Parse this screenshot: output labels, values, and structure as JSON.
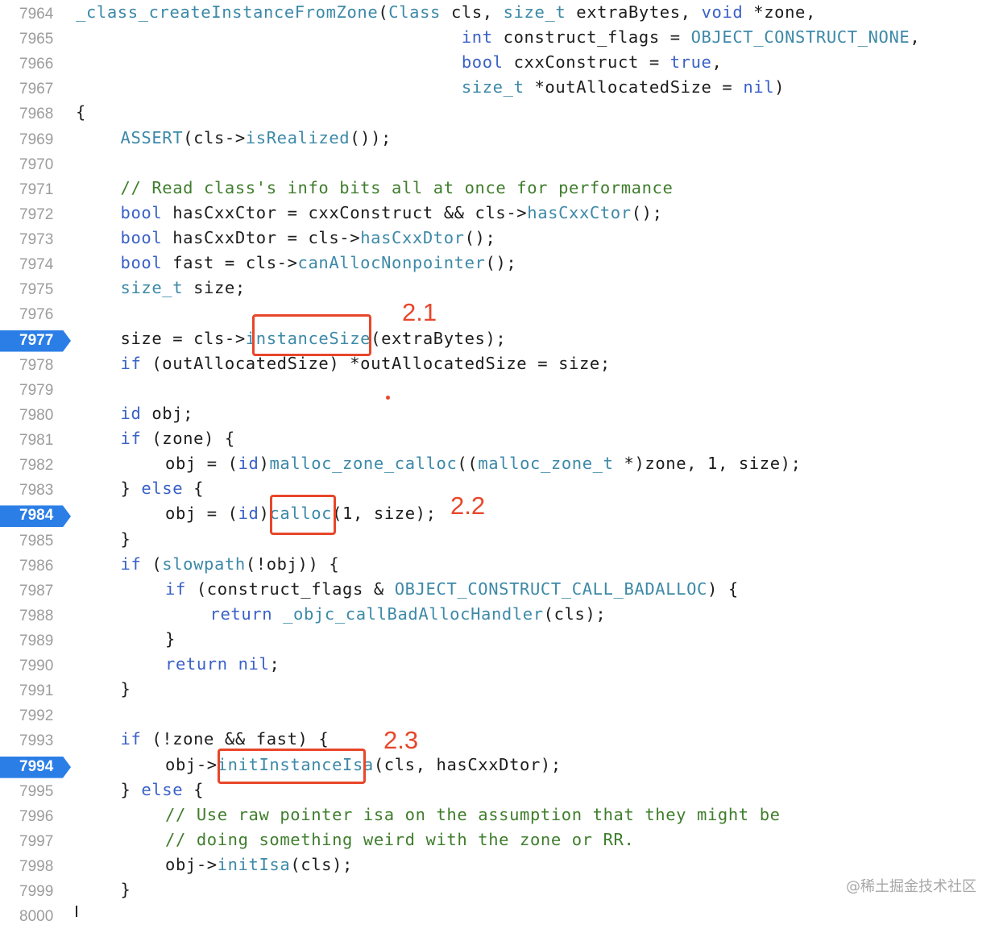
{
  "lines": [
    {
      "num": "7964",
      "indent": 0,
      "tokens": [
        {
          "t": "_class_createInstanceFromZone",
          "c": "fn"
        },
        {
          "t": "(",
          "c": "pl"
        },
        {
          "t": "Class",
          "c": "fn"
        },
        {
          "t": " cls, ",
          "c": "pl"
        },
        {
          "t": "size_t",
          "c": "fn"
        },
        {
          "t": " extraBytes, ",
          "c": "pl"
        },
        {
          "t": "void",
          "c": "kw"
        },
        {
          "t": " *zone,",
          "c": "pl"
        }
      ]
    },
    {
      "num": "7965",
      "indent": 0,
      "tokens": [
        {
          "t": "                                     ",
          "c": "pl"
        },
        {
          "t": "int",
          "c": "kw"
        },
        {
          "t": " construct_flags = ",
          "c": "pl"
        },
        {
          "t": "OBJECT_CONSTRUCT_NONE",
          "c": "mac"
        },
        {
          "t": ",",
          "c": "pl"
        }
      ]
    },
    {
      "num": "7966",
      "indent": 0,
      "tokens": [
        {
          "t": "                                     ",
          "c": "pl"
        },
        {
          "t": "bool",
          "c": "kw"
        },
        {
          "t": " cxxConstruct = ",
          "c": "pl"
        },
        {
          "t": "true",
          "c": "kw"
        },
        {
          "t": ",",
          "c": "pl"
        }
      ]
    },
    {
      "num": "7967",
      "indent": 0,
      "tokens": [
        {
          "t": "                                     ",
          "c": "pl"
        },
        {
          "t": "size_t",
          "c": "fn"
        },
        {
          "t": " *outAllocatedSize = ",
          "c": "pl"
        },
        {
          "t": "nil",
          "c": "kw"
        },
        {
          "t": ")",
          "c": "pl"
        }
      ]
    },
    {
      "num": "7968",
      "indent": 0,
      "tokens": [
        {
          "t": "{",
          "c": "pl"
        }
      ]
    },
    {
      "num": "7969",
      "indent": 1,
      "tokens": [
        {
          "t": "ASSERT",
          "c": "mac"
        },
        {
          "t": "(cls->",
          "c": "pl"
        },
        {
          "t": "isRealized",
          "c": "fn"
        },
        {
          "t": "());",
          "c": "pl"
        }
      ]
    },
    {
      "num": "7970",
      "indent": 0,
      "tokens": []
    },
    {
      "num": "7971",
      "indent": 1,
      "tokens": [
        {
          "t": "// Read class's info bits all at once for performance",
          "c": "cm"
        }
      ]
    },
    {
      "num": "7972",
      "indent": 1,
      "tokens": [
        {
          "t": "bool",
          "c": "kw"
        },
        {
          "t": " hasCxxCtor = cxxConstruct && cls->",
          "c": "pl"
        },
        {
          "t": "hasCxxCtor",
          "c": "fn"
        },
        {
          "t": "();",
          "c": "pl"
        }
      ]
    },
    {
      "num": "7973",
      "indent": 1,
      "tokens": [
        {
          "t": "bool",
          "c": "kw"
        },
        {
          "t": " hasCxxDtor = cls->",
          "c": "pl"
        },
        {
          "t": "hasCxxDtor",
          "c": "fn"
        },
        {
          "t": "();",
          "c": "pl"
        }
      ]
    },
    {
      "num": "7974",
      "indent": 1,
      "tokens": [
        {
          "t": "bool",
          "c": "kw"
        },
        {
          "t": " fast = cls->",
          "c": "pl"
        },
        {
          "t": "canAllocNonpointer",
          "c": "fn"
        },
        {
          "t": "();",
          "c": "pl"
        }
      ]
    },
    {
      "num": "7975",
      "indent": 1,
      "tokens": [
        {
          "t": "size_t",
          "c": "fn"
        },
        {
          "t": " size;",
          "c": "pl"
        }
      ]
    },
    {
      "num": "7976",
      "indent": 0,
      "tokens": []
    },
    {
      "num": "7977",
      "indent": 1,
      "bp": true,
      "tokens": [
        {
          "t": "size = cls->",
          "c": "pl"
        },
        {
          "t": "instanceSize",
          "c": "fn"
        },
        {
          "t": "(extraBytes);",
          "c": "pl"
        }
      ]
    },
    {
      "num": "7978",
      "indent": 1,
      "tokens": [
        {
          "t": "if",
          "c": "kw"
        },
        {
          "t": " (outAllocatedSize) *outAllocatedSize = size;",
          "c": "pl"
        }
      ]
    },
    {
      "num": "7979",
      "indent": 0,
      "tokens": []
    },
    {
      "num": "7980",
      "indent": 1,
      "tokens": [
        {
          "t": "id",
          "c": "kw"
        },
        {
          "t": " obj;",
          "c": "pl"
        }
      ]
    },
    {
      "num": "7981",
      "indent": 1,
      "tokens": [
        {
          "t": "if",
          "c": "kw"
        },
        {
          "t": " (zone) {",
          "c": "pl"
        }
      ]
    },
    {
      "num": "7982",
      "indent": 2,
      "tokens": [
        {
          "t": "obj = (",
          "c": "pl"
        },
        {
          "t": "id",
          "c": "kw"
        },
        {
          "t": ")",
          "c": "pl"
        },
        {
          "t": "malloc_zone_calloc",
          "c": "fn"
        },
        {
          "t": "((",
          "c": "pl"
        },
        {
          "t": "malloc_zone_t",
          "c": "fn"
        },
        {
          "t": " *)zone, 1, size);",
          "c": "pl"
        }
      ]
    },
    {
      "num": "7983",
      "indent": 1,
      "tokens": [
        {
          "t": "} ",
          "c": "pl"
        },
        {
          "t": "else",
          "c": "kw"
        },
        {
          "t": " {",
          "c": "pl"
        }
      ]
    },
    {
      "num": "7984",
      "indent": 2,
      "bp": true,
      "tokens": [
        {
          "t": "obj = (",
          "c": "pl"
        },
        {
          "t": "id",
          "c": "kw"
        },
        {
          "t": ")",
          "c": "pl"
        },
        {
          "t": "calloc",
          "c": "fn"
        },
        {
          "t": "(1, size);",
          "c": "pl"
        }
      ]
    },
    {
      "num": "7985",
      "indent": 1,
      "tokens": [
        {
          "t": "}",
          "c": "pl"
        }
      ]
    },
    {
      "num": "7986",
      "indent": 1,
      "tokens": [
        {
          "t": "if",
          "c": "kw"
        },
        {
          "t": " (",
          "c": "pl"
        },
        {
          "t": "slowpath",
          "c": "fn"
        },
        {
          "t": "(!obj)) {",
          "c": "pl"
        }
      ]
    },
    {
      "num": "7987",
      "indent": 2,
      "tokens": [
        {
          "t": "if",
          "c": "kw"
        },
        {
          "t": " (construct_flags & ",
          "c": "pl"
        },
        {
          "t": "OBJECT_CONSTRUCT_CALL_BADALLOC",
          "c": "mac"
        },
        {
          "t": ") {",
          "c": "pl"
        }
      ]
    },
    {
      "num": "7988",
      "indent": 3,
      "tokens": [
        {
          "t": "return",
          "c": "kw"
        },
        {
          "t": " ",
          "c": "pl"
        },
        {
          "t": "_objc_callBadAllocHandler",
          "c": "fn"
        },
        {
          "t": "(cls);",
          "c": "pl"
        }
      ]
    },
    {
      "num": "7989",
      "indent": 2,
      "tokens": [
        {
          "t": "}",
          "c": "pl"
        }
      ]
    },
    {
      "num": "7990",
      "indent": 2,
      "tokens": [
        {
          "t": "return",
          "c": "kw"
        },
        {
          "t": " ",
          "c": "pl"
        },
        {
          "t": "nil",
          "c": "kw"
        },
        {
          "t": ";",
          "c": "pl"
        }
      ]
    },
    {
      "num": "7991",
      "indent": 1,
      "tokens": [
        {
          "t": "}",
          "c": "pl"
        }
      ]
    },
    {
      "num": "7992",
      "indent": 0,
      "tokens": []
    },
    {
      "num": "7993",
      "indent": 1,
      "tokens": [
        {
          "t": "if",
          "c": "kw"
        },
        {
          "t": " (!zone && fast) {",
          "c": "pl"
        }
      ]
    },
    {
      "num": "7994",
      "indent": 2,
      "bp": true,
      "tokens": [
        {
          "t": "obj->",
          "c": "pl"
        },
        {
          "t": "initInstanceIsa",
          "c": "fn"
        },
        {
          "t": "(cls, hasCxxDtor);",
          "c": "pl"
        }
      ]
    },
    {
      "num": "7995",
      "indent": 1,
      "tokens": [
        {
          "t": "} ",
          "c": "pl"
        },
        {
          "t": "else",
          "c": "kw"
        },
        {
          "t": " {",
          "c": "pl"
        }
      ]
    },
    {
      "num": "7996",
      "indent": 2,
      "tokens": [
        {
          "t": "// Use raw pointer isa on the assumption that they might be",
          "c": "cm"
        }
      ]
    },
    {
      "num": "7997",
      "indent": 2,
      "tokens": [
        {
          "t": "// doing something weird with the zone or RR.",
          "c": "cm"
        }
      ]
    },
    {
      "num": "7998",
      "indent": 2,
      "tokens": [
        {
          "t": "obj->",
          "c": "pl"
        },
        {
          "t": "initIsa",
          "c": "fn"
        },
        {
          "t": "(cls);",
          "c": "pl"
        }
      ]
    },
    {
      "num": "7999",
      "indent": 1,
      "tokens": [
        {
          "t": "}",
          "c": "pl"
        }
      ]
    },
    {
      "num": "8000",
      "indent": 0,
      "tokens": []
    }
  ],
  "annotations": [
    {
      "label": "2.1"
    },
    {
      "label": "2.2"
    },
    {
      "label": "2.3"
    }
  ],
  "watermark": "@稀土掘金技术社区",
  "colors": {
    "breakpoint": "#2b7ee6",
    "annotation": "#e8462a",
    "keyword": "#3a61c7",
    "function": "#3d89a8",
    "comment": "#3f7d2c"
  }
}
